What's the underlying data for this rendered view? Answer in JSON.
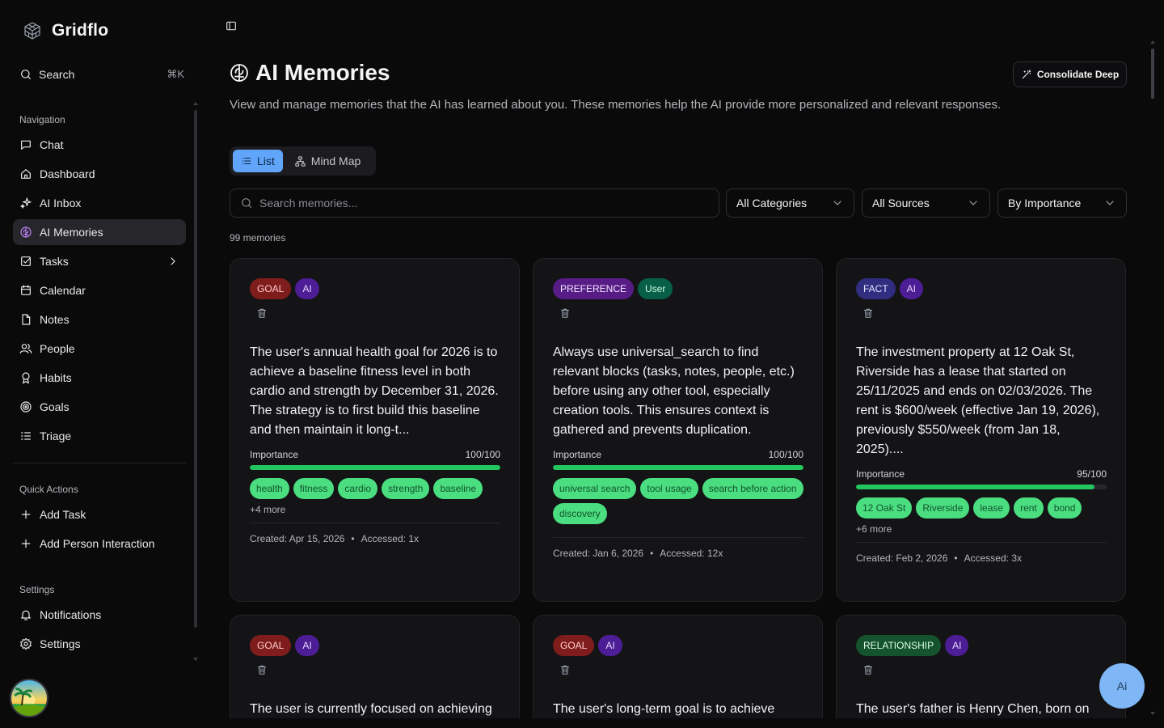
{
  "app": {
    "name": "Gridflo"
  },
  "sidebar": {
    "search_label": "Search",
    "search_shortcut": "⌘K",
    "nav_title": "Navigation",
    "nav_items": [
      {
        "label": "Chat",
        "icon": "chat-icon"
      },
      {
        "label": "Dashboard",
        "icon": "home-icon"
      },
      {
        "label": "AI Inbox",
        "icon": "sparkles-icon"
      },
      {
        "label": "AI Memories",
        "icon": "brain-icon",
        "active": true
      },
      {
        "label": "Tasks",
        "icon": "checkbox-icon",
        "has_submenu": true
      },
      {
        "label": "Calendar",
        "icon": "calendar-icon"
      },
      {
        "label": "Notes",
        "icon": "note-icon"
      },
      {
        "label": "People",
        "icon": "people-icon"
      },
      {
        "label": "Habits",
        "icon": "ribbon-icon"
      },
      {
        "label": "Goals",
        "icon": "target-icon"
      },
      {
        "label": "Triage",
        "icon": "list-filter-icon"
      }
    ],
    "quick_title": "Quick Actions",
    "quick_items": [
      {
        "label": "Add Task",
        "icon": "plus-icon"
      },
      {
        "label": "Add Person Interaction",
        "icon": "plus-icon"
      }
    ],
    "settings_title": "Settings",
    "settings_items": [
      {
        "label": "Notifications",
        "icon": "bell-icon"
      },
      {
        "label": "Settings",
        "icon": "gear-icon"
      }
    ]
  },
  "main": {
    "title": "AI Memories",
    "consolidate_label": "Consolidate Deep",
    "description": "View and manage memories that the AI has learned about you. These memories help the AI provide more personalized and relevant responses.",
    "view_tabs": [
      {
        "label": "List",
        "active": true
      },
      {
        "label": "Mind Map",
        "active": false
      }
    ],
    "search_placeholder": "Search memories...",
    "filters": {
      "category": "All Categories",
      "source": "All Sources",
      "sort": "By Importance"
    },
    "count_text": "99 memories",
    "importance_label": "Importance",
    "cards": [
      {
        "category": "GOAL",
        "source": "AI",
        "content": "The user's annual health goal for 2026 is to achieve a baseline fitness level in both cardio and strength by December 31, 2026. The strategy is to first build this baseline and then maintain it long-t...",
        "importance": 100,
        "importance_text": "100/100",
        "tags": [
          "health",
          "fitness",
          "cardio",
          "strength",
          "baseline"
        ],
        "more": "+4 more",
        "created": "Created: Apr 15, 2026",
        "accessed": "Accessed: 1x"
      },
      {
        "category": "PREFERENCE",
        "source": "User",
        "content": "Always use universal_search to find relevant blocks (tasks, notes, people, etc.) before using any other tool, especially creation tools. This ensures context is gathered and prevents duplication.",
        "importance": 100,
        "importance_text": "100/100",
        "tags": [
          "universal search",
          "tool usage",
          "search before action",
          "discovery"
        ],
        "more": "",
        "created": "Created: Jan 6, 2026",
        "accessed": "Accessed: 12x"
      },
      {
        "category": "FACT",
        "source": "AI",
        "content": "The investment property at 12 Oak St, Riverside has a lease that started on 25/11/2025 and ends on 02/03/2026. The rent is $600/week (effective Jan 19, 2026), previously $550/week (from Jan 18, 2025)....",
        "importance": 95,
        "importance_text": "95/100",
        "tags": [
          "12 Oak St",
          "Riverside",
          "lease",
          "rent",
          "bond"
        ],
        "more": "+6 more",
        "created": "Created: Feb 2, 2026",
        "accessed": "Accessed: 3x"
      },
      {
        "category": "GOAL",
        "source": "AI",
        "content": "The user is currently focused on achieving"
      },
      {
        "category": "GOAL",
        "source": "AI",
        "content": "The user's long-term goal is to achieve"
      },
      {
        "category": "RELATIONSHIP",
        "source": "AI",
        "content": "The user's father is Henry Chen, born on"
      }
    ],
    "assistant_button": "Ai"
  },
  "colors": {
    "goal_bg": "#7f1d1d",
    "goal_fg": "#fecaca",
    "preference_bg": "#581c87",
    "preference_fg": "#f3e8ff",
    "fact_bg": "#312e81",
    "fact_fg": "#e0e7ff",
    "relationship_bg": "#14532d",
    "relationship_fg": "#dcfce7",
    "source_ai_bg": "#4c1d95",
    "source_user_bg": "#065f46",
    "importance_bar": "#22c55e",
    "tag_bg": "#4ade80",
    "accent": "#60a5fa"
  }
}
